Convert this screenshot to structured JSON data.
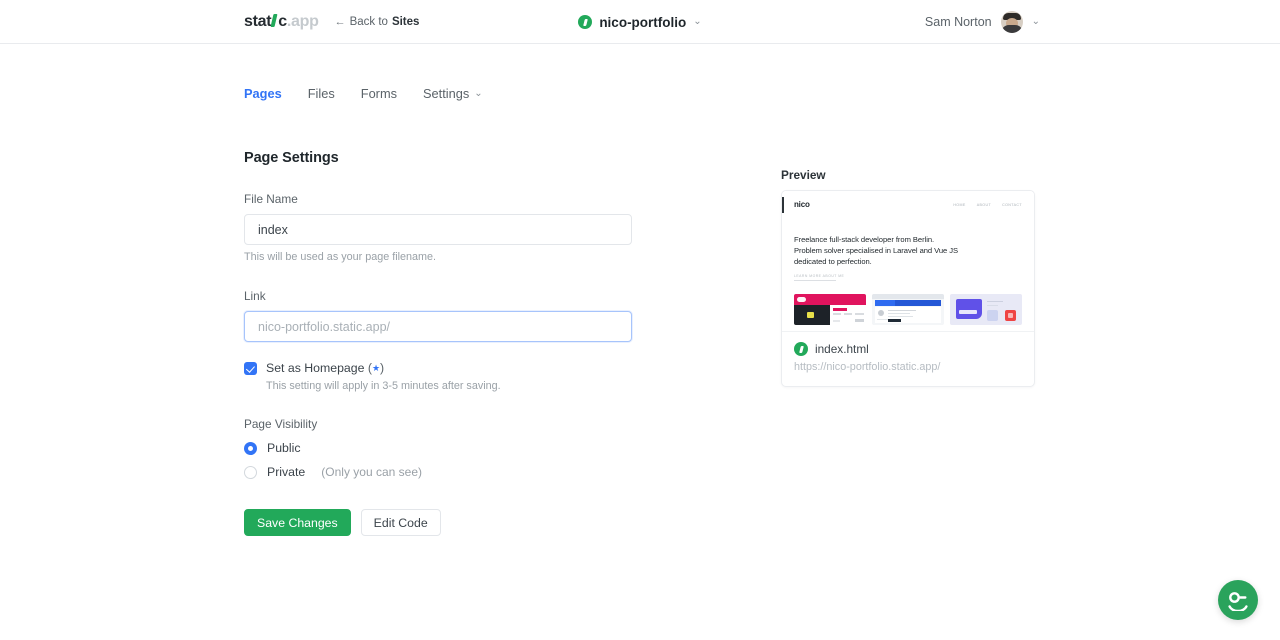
{
  "header": {
    "logo_dark": "stat",
    "logo_mark_icon": "green-i-mark",
    "logo_c": "c",
    "logo_light": ".app",
    "back_arrow": "←",
    "back_prefix": "Back to ",
    "back_target": "Sites",
    "site_badge_icon": "static-app-badge-icon",
    "site_name": "nico-portfolio",
    "site_chevron": "⌄",
    "user_name": "Sam Norton",
    "user_chevron": "⌄",
    "avatar_icon": "user-avatar"
  },
  "tabs": [
    {
      "label": "Pages",
      "active": true,
      "chevron": ""
    },
    {
      "label": "Files",
      "active": false,
      "chevron": ""
    },
    {
      "label": "Forms",
      "active": false,
      "chevron": ""
    },
    {
      "label": "Settings",
      "active": false,
      "chevron": "⌄"
    }
  ],
  "form": {
    "title": "Page Settings",
    "file_name": {
      "label": "File Name",
      "value": "index",
      "placeholder": "index",
      "help": "This will be used as your page filename."
    },
    "link": {
      "label": "Link",
      "value": "",
      "placeholder": "nico-portfolio.static.app/"
    },
    "homepage": {
      "label": "Set as Homepage",
      "star": "★",
      "open_paren": "(",
      "close_paren": ")",
      "checked": true,
      "help": "This setting will apply in 3-5 minutes after saving."
    },
    "visibility": {
      "label": "Page Visibility",
      "options": [
        {
          "label": "Public",
          "note": "",
          "selected": true
        },
        {
          "label": "Private",
          "note": "(Only you can see)",
          "selected": false
        }
      ]
    },
    "buttons": {
      "save": "Save Changes",
      "edit_code": "Edit Code"
    }
  },
  "preview": {
    "title": "Preview",
    "site": {
      "logo": "nico",
      "nav": [
        "home",
        "about",
        "contact"
      ],
      "headline_line1": "Freelance full-stack developer from Berlin.",
      "headline_line2": "Problem solver specialised in Laravel and Vue JS",
      "headline_line3": "dedicated to perfection.",
      "cta": "LEARN MORE ABOUT ME"
    },
    "file_badge_icon": "static-app-badge-icon",
    "file_name": "index.html",
    "file_url": "https://nico-portfolio.static.app/"
  },
  "chat": {
    "icon": "chat-support-icon",
    "color": "#2aa35c"
  },
  "colors": {
    "accent_blue": "#3274f6",
    "brand_green": "#22a95a",
    "text_dark": "#1f262b",
    "text_muted": "#9aa1a7",
    "border": "#e3e6ea"
  }
}
